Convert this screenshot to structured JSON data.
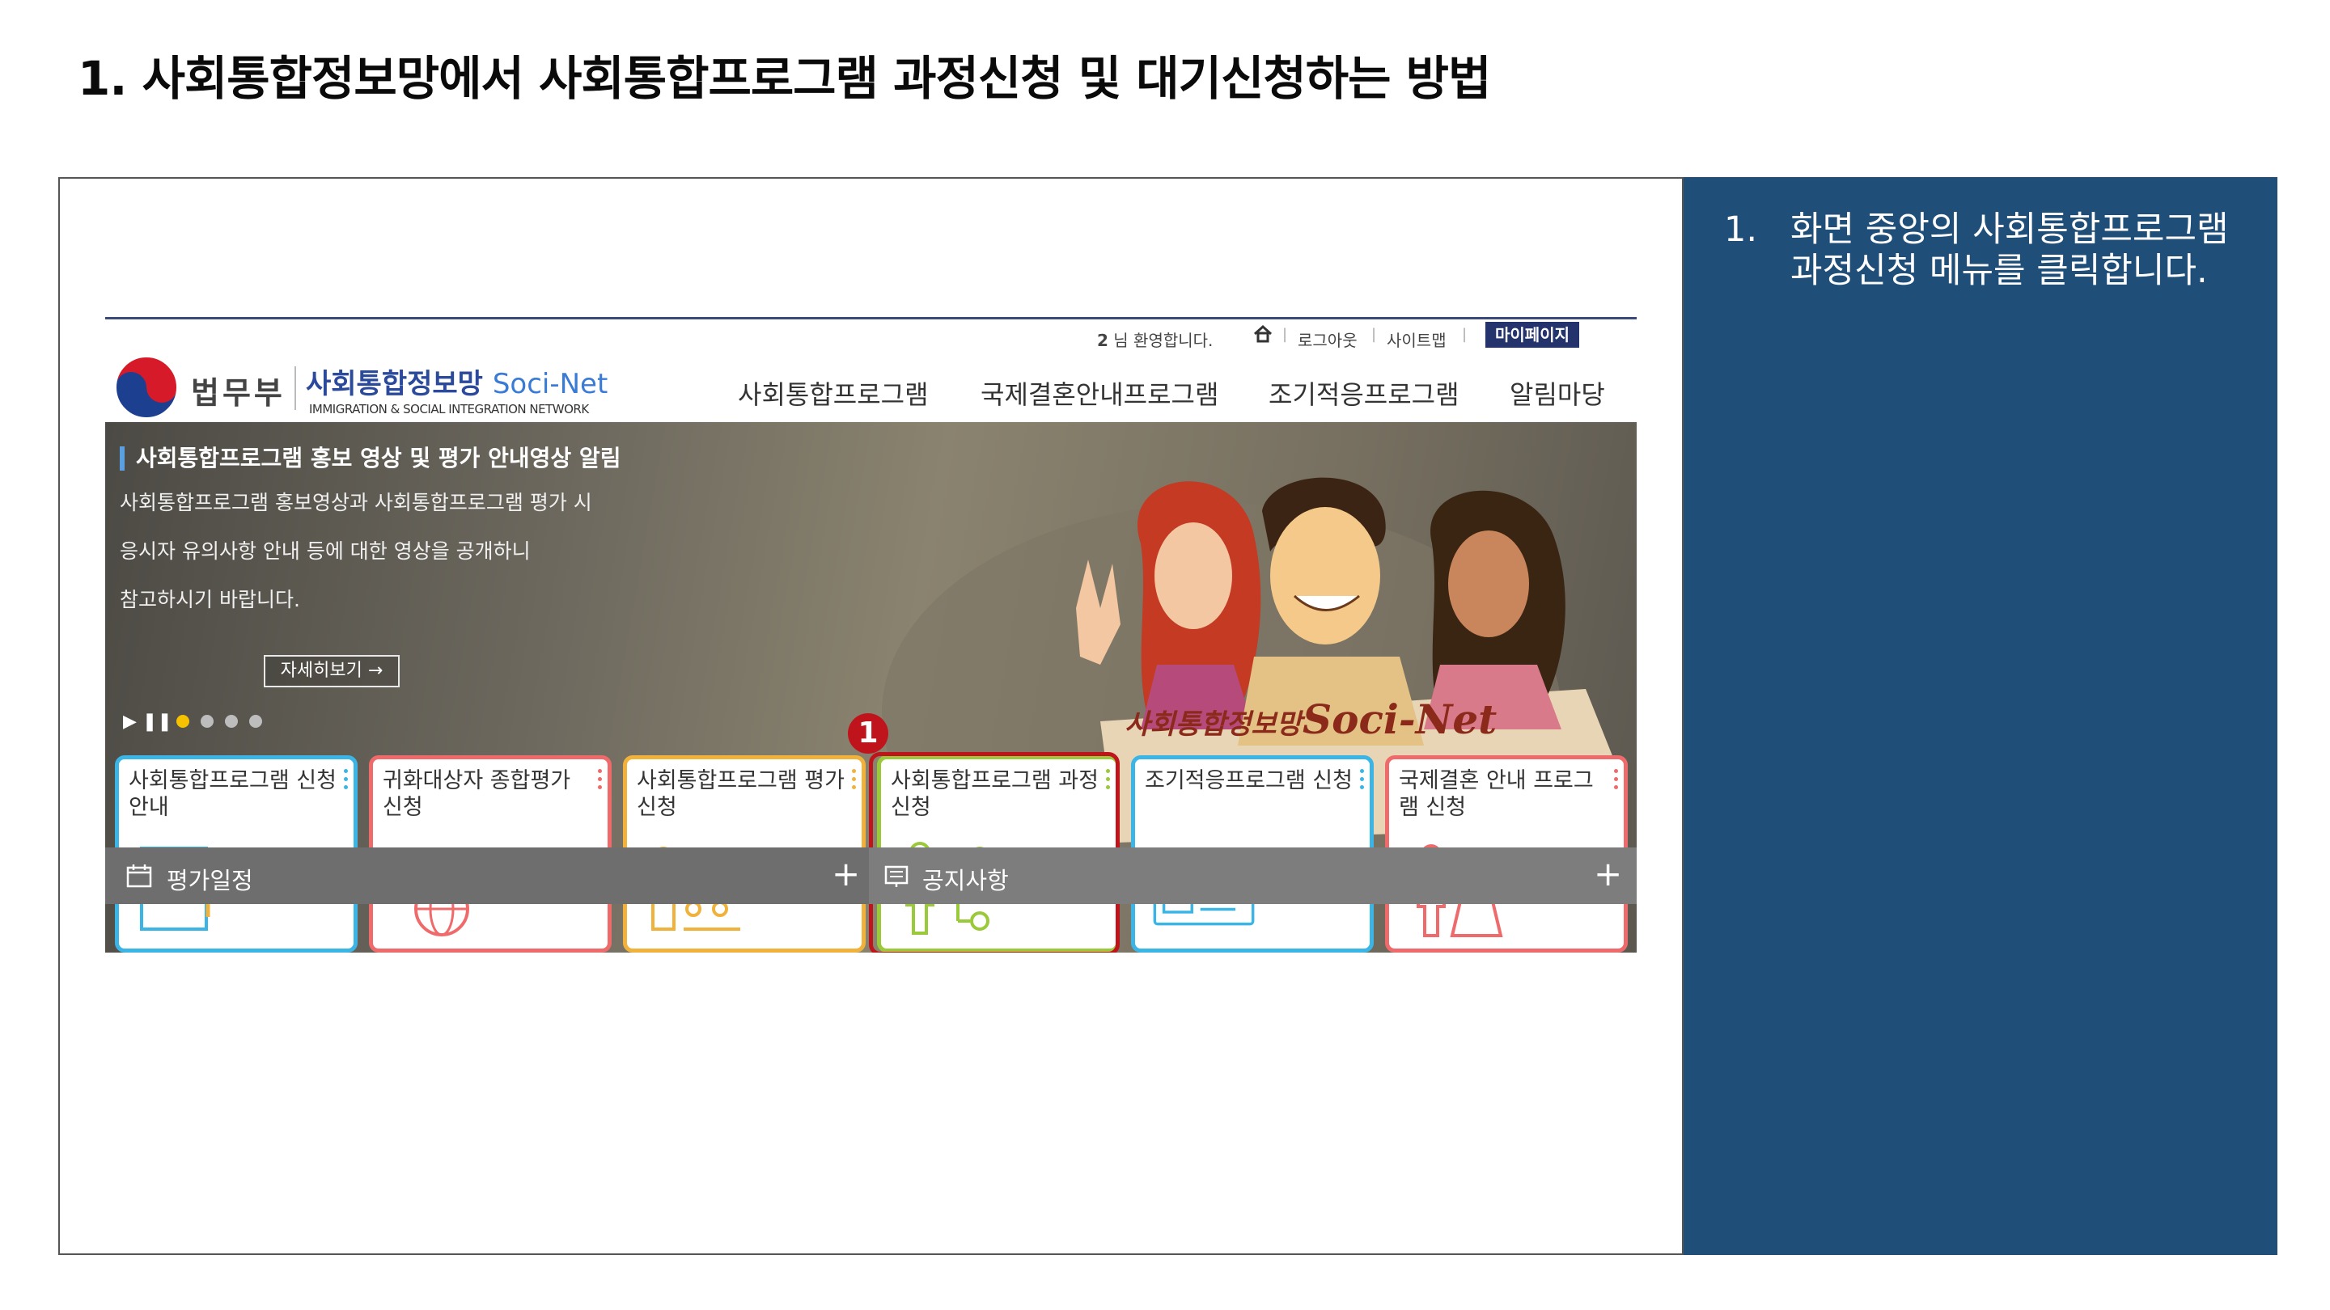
{
  "slide": {
    "title": "1. 사회통합정보망에서 사회통합프로그램 과정신청 및 대기신청하는 방법"
  },
  "instructions": [
    {
      "num": "1.",
      "text": "화면 중앙의 사회통합프로그램 과정신청 메뉴를 클릭합니다."
    }
  ],
  "site": {
    "utility": {
      "welcome_num": "2",
      "welcome_text": "님 환영합니다.",
      "logout": "로그아웃",
      "sitemap": "사이트맵",
      "mypage": "마이페이지"
    },
    "logo": {
      "ministry": "법무부",
      "brand": "사회통합정보망",
      "brand_en": "Soci-Net",
      "subtitle": "IMMIGRATION & SOCIAL INTEGRATION NETWORK"
    },
    "nav": [
      "사회통합프로그램",
      "국제결혼안내프로그램",
      "조기적응프로그램",
      "알림마당"
    ],
    "hero": {
      "notice_title": "사회통합프로그램 홍보 영상 및 평가 안내영상 알림",
      "notice_lines": [
        "사회통합프로그램 홍보영상과 사회통합프로그램 평가 시",
        "응시자 유의사항 안내 등에 대한 영상을 공개하니",
        "참고하시기 바랍니다."
      ],
      "more_button": "자세히보기 →",
      "signature_ko": "사회통합정보망",
      "signature_en": "Soci-Net"
    },
    "cards": [
      {
        "title": "사회통합프로그램 신청안내",
        "icon": "book-magnifier-icon",
        "color": "#3bb4e6"
      },
      {
        "title": "귀화대상자 종합평가 신청",
        "icon": "graduation-globe-icon",
        "color": "#ef6b6b"
      },
      {
        "title": "사회통합프로그램 평가신청",
        "icon": "presentation-class-icon",
        "color": "#f0b23a"
      },
      {
        "title": "사회통합프로그램 과정신청",
        "icon": "person-checklist-icon",
        "color": "#9ac93a"
      },
      {
        "title": "조기적응프로그램 신청",
        "icon": "id-card-icon",
        "color": "#3bb4e6"
      },
      {
        "title": "국제결혼 안내 프로그램 신청",
        "icon": "couple-icon",
        "color": "#ef6b6b"
      }
    ],
    "step_marker": "1",
    "bottom_bar": {
      "left_label": "평가일정",
      "right_label": "공지사항",
      "plus": "+"
    }
  },
  "colors": {
    "side_panel": "#1f4e79",
    "highlight": "#c0141c",
    "mypage_button": "#24336b"
  }
}
